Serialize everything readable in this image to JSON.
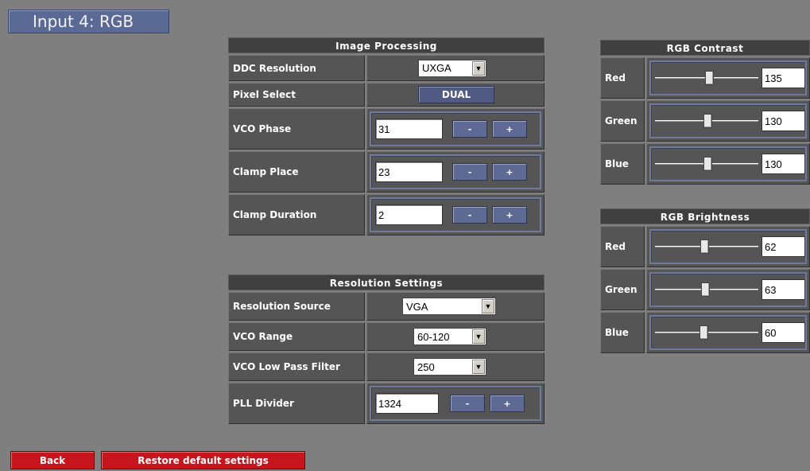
{
  "page": {
    "title": "Input 4: RGB"
  },
  "image_processing": {
    "header": "Image Processing",
    "ddc_resolution": {
      "label": "DDC Resolution",
      "value": "UXGA"
    },
    "pixel_select": {
      "label": "Pixel Select",
      "value": "DUAL"
    },
    "vco_phase": {
      "label": "VCO Phase",
      "value": "31"
    },
    "clamp_place": {
      "label": "Clamp Place",
      "value": "23"
    },
    "clamp_duration": {
      "label": "Clamp Duration",
      "value": "2"
    },
    "minus_label": "-",
    "plus_label": "+"
  },
  "resolution_settings": {
    "header": "Resolution Settings",
    "resolution_source": {
      "label": "Resolution Source",
      "value": "VGA"
    },
    "vco_range": {
      "label": "VCO Range",
      "value": "60-120"
    },
    "vco_low_pass_filter": {
      "label": "VCO Low Pass Filter",
      "value": "250"
    },
    "pll_divider": {
      "label": "PLL Divider",
      "value": "1324"
    }
  },
  "rgb_contrast": {
    "header": "RGB Contrast",
    "channels": [
      {
        "label": "Red",
        "value": "135",
        "level": 0.53
      },
      {
        "label": "Green",
        "value": "130",
        "level": 0.51
      },
      {
        "label": "Blue",
        "value": "130",
        "level": 0.51
      }
    ]
  },
  "rgb_brightness": {
    "header": "RGB Brightness",
    "channels": [
      {
        "label": "Red",
        "value": "62",
        "level": 0.48
      },
      {
        "label": "Green",
        "value": "63",
        "level": 0.49
      },
      {
        "label": "Blue",
        "value": "60",
        "level": 0.47
      }
    ]
  },
  "footer": {
    "back_label": "Back",
    "restore_label": "Restore default settings"
  },
  "colors": {
    "background": "#7f7f7f",
    "panel_header": "#404040",
    "cell": "#555555",
    "accent_blue": "#5b6a94",
    "button_red": "#c8141c"
  }
}
